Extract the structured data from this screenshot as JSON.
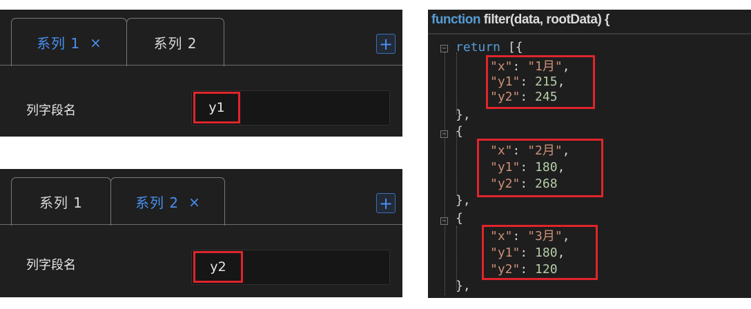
{
  "panel1": {
    "tabs": [
      {
        "label": "系列 1",
        "close": "×",
        "active": true
      },
      {
        "label": "系列 2",
        "close": "",
        "active": false
      }
    ],
    "add_button": "+",
    "field_label": "列字段名",
    "field_value": "y1"
  },
  "panel2": {
    "tabs": [
      {
        "label": "系列 1",
        "close": "",
        "active": false
      },
      {
        "label": "系列 2",
        "close": "×",
        "active": true
      }
    ],
    "add_button": "+",
    "field_label": "列字段名",
    "field_value": "y2"
  },
  "code": {
    "header_keyword": "function",
    "header_rest": " filter(data, rootData) {",
    "return_keyword": "return",
    "return_open": " [{",
    "open_brace": "{",
    "close_brace": "},",
    "records": [
      {
        "x_key": "\"x\"",
        "x_val": "\"1月\"",
        "y1_key": "\"y1\"",
        "y1_val": "215",
        "y2_key": "\"y2\"",
        "y2_val": "245"
      },
      {
        "x_key": "\"x\"",
        "x_val": "\"2月\"",
        "y1_key": "\"y1\"",
        "y1_val": "180",
        "y2_key": "\"y2\"",
        "y2_val": "268"
      },
      {
        "x_key": "\"x\"",
        "x_val": "\"3月\"",
        "y1_key": "\"y1\"",
        "y1_val": "180",
        "y2_key": "\"y2\"",
        "y2_val": "120"
      }
    ]
  },
  "colors": {
    "accent": "#4a90f2",
    "highlight": "#e0252b",
    "panel_bg": "#1f1f1f",
    "code_bg": "#1e1e1e"
  }
}
